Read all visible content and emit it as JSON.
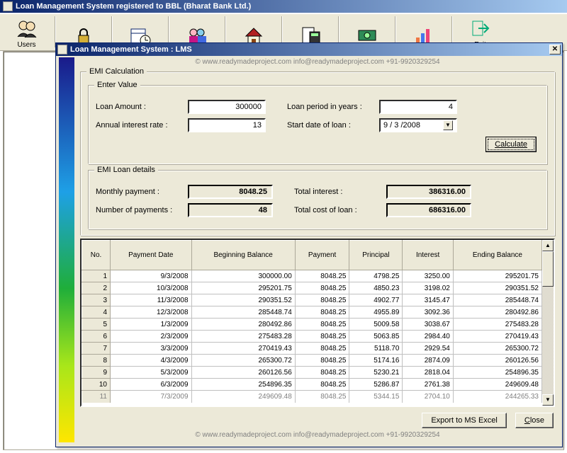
{
  "main_title": "Loan Management System registered to BBL (Bharat Bank Ltd.)",
  "toolbar": [
    {
      "label": "Users"
    },
    {
      "label": ""
    },
    {
      "label": ""
    },
    {
      "label": ""
    },
    {
      "label": ""
    },
    {
      "label": ""
    },
    {
      "label": ""
    },
    {
      "label": ""
    },
    {
      "label": "Exit"
    }
  ],
  "watermark_company": "k Ltd.",
  "dialog": {
    "title": "Loan Management System : LMS",
    "footer": "©  www.readymadeproject.com  info@readymadeproject.com  +91-9920329254",
    "emi_calc_title": "EMI Calculation",
    "enter_value_title": "Enter Value",
    "labels": {
      "loan_amount": "Loan Amount :",
      "loan_period": "Loan period in years :",
      "annual_rate": "Annual interest rate :",
      "start_date": "Start date of loan :",
      "calculate": "Calculate",
      "monthly_payment": "Monthly payment :",
      "total_interest": "Total interest :",
      "num_payments": "Number of payments :",
      "total_cost": "Total cost of loan :"
    },
    "inputs": {
      "loan_amount": "300000",
      "loan_period": "4",
      "annual_rate": "13",
      "start_date": "9 / 3 /2008"
    },
    "loan_details_title": "EMI Loan details",
    "results": {
      "monthly_payment": "8048.25",
      "total_interest": "386316.00",
      "num_payments": "48",
      "total_cost": "686316.00"
    },
    "table": {
      "headers": [
        "No.",
        "Payment Date",
        "Beginning Balance",
        "Payment",
        "Principal",
        "Interest",
        "Ending Balance"
      ],
      "rows": [
        [
          "1",
          "9/3/2008",
          "300000.00",
          "8048.25",
          "4798.25",
          "3250.00",
          "295201.75"
        ],
        [
          "2",
          "10/3/2008",
          "295201.75",
          "8048.25",
          "4850.23",
          "3198.02",
          "290351.52"
        ],
        [
          "3",
          "11/3/2008",
          "290351.52",
          "8048.25",
          "4902.77",
          "3145.47",
          "285448.74"
        ],
        [
          "4",
          "12/3/2008",
          "285448.74",
          "8048.25",
          "4955.89",
          "3092.36",
          "280492.86"
        ],
        [
          "5",
          "1/3/2009",
          "280492.86",
          "8048.25",
          "5009.58",
          "3038.67",
          "275483.28"
        ],
        [
          "6",
          "2/3/2009",
          "275483.28",
          "8048.25",
          "5063.85",
          "2984.40",
          "270419.43"
        ],
        [
          "7",
          "3/3/2009",
          "270419.43",
          "8048.25",
          "5118.70",
          "2929.54",
          "265300.72"
        ],
        [
          "8",
          "4/3/2009",
          "265300.72",
          "8048.25",
          "5174.16",
          "2874.09",
          "260126.56"
        ],
        [
          "9",
          "5/3/2009",
          "260126.56",
          "8048.25",
          "5230.21",
          "2818.04",
          "254896.35"
        ],
        [
          "10",
          "6/3/2009",
          "254896.35",
          "8048.25",
          "5286.87",
          "2761.38",
          "249609.48"
        ],
        [
          "11",
          "7/3/2009",
          "249609.48",
          "8048.25",
          "5344.15",
          "2704.10",
          "244265.33"
        ]
      ]
    },
    "buttons": {
      "export": "Export to MS Excel",
      "close": "Close"
    }
  }
}
